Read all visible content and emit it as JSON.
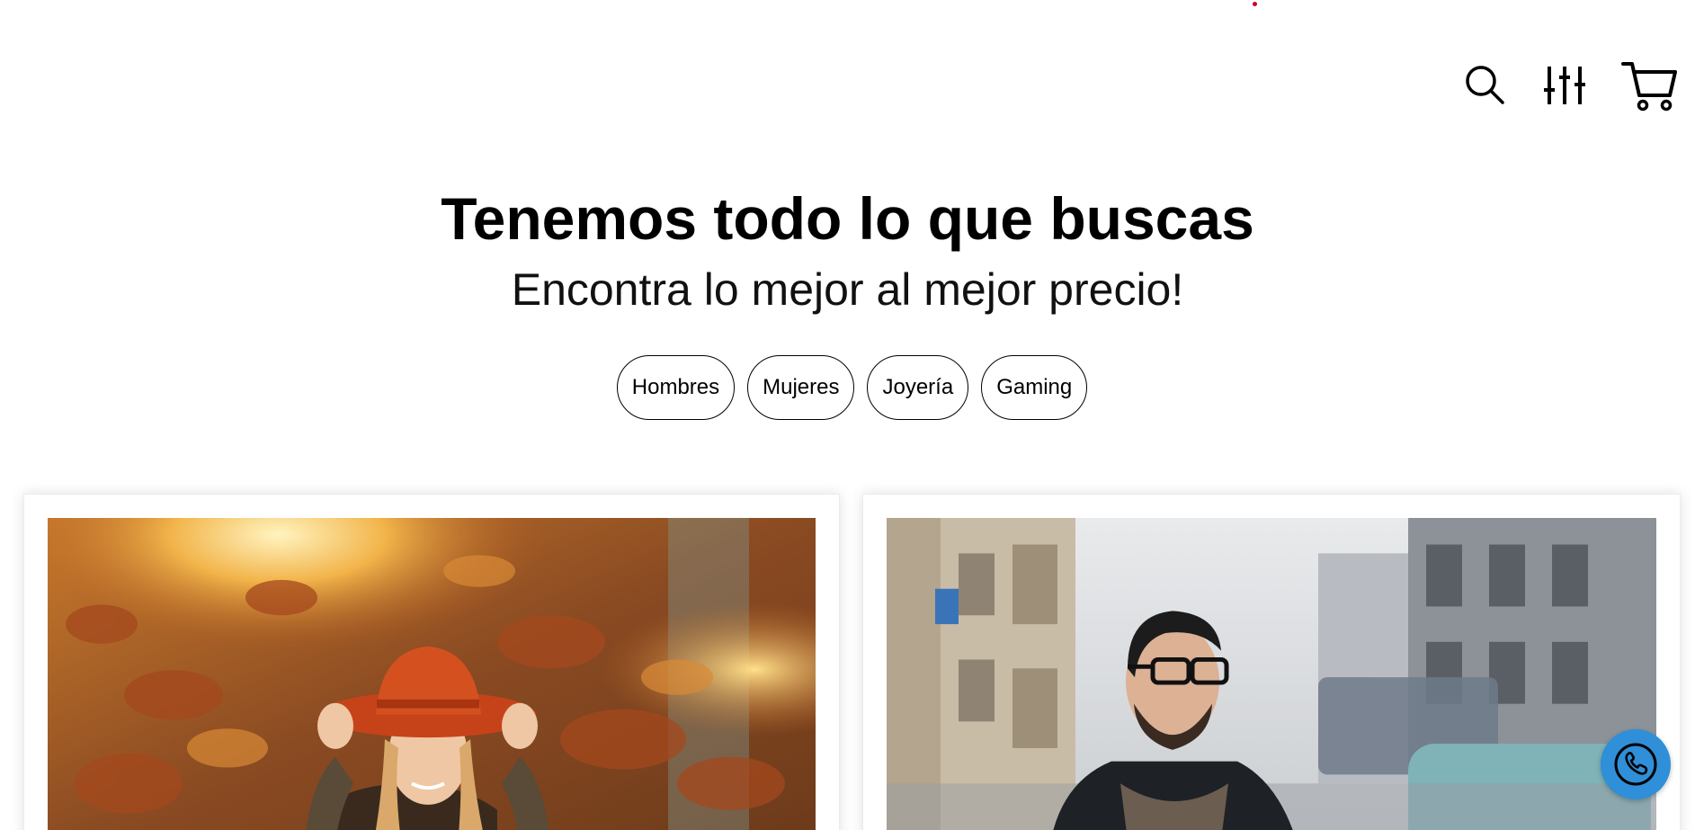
{
  "header": {
    "icons": [
      "search-icon",
      "filter-sliders-icon",
      "cart-icon"
    ]
  },
  "hero": {
    "title": "Tenemos todo lo que buscas",
    "subtitle": "Encontra lo mejor al mejor precio!"
  },
  "categories": [
    {
      "label": "Hombres"
    },
    {
      "label": "Mujeres"
    },
    {
      "label": "Joyería"
    },
    {
      "label": "Gaming"
    }
  ],
  "cards": [
    {
      "image": "woman-orange-hat-autumn-photo"
    },
    {
      "image": "man-glasses-city-street-photo"
    }
  ],
  "floating": {
    "icon": "phone-icon",
    "color": "#2f8fd8"
  },
  "colors": {
    "accent_dot": "#d0021b",
    "text": "#000000",
    "background": "#ffffff"
  }
}
